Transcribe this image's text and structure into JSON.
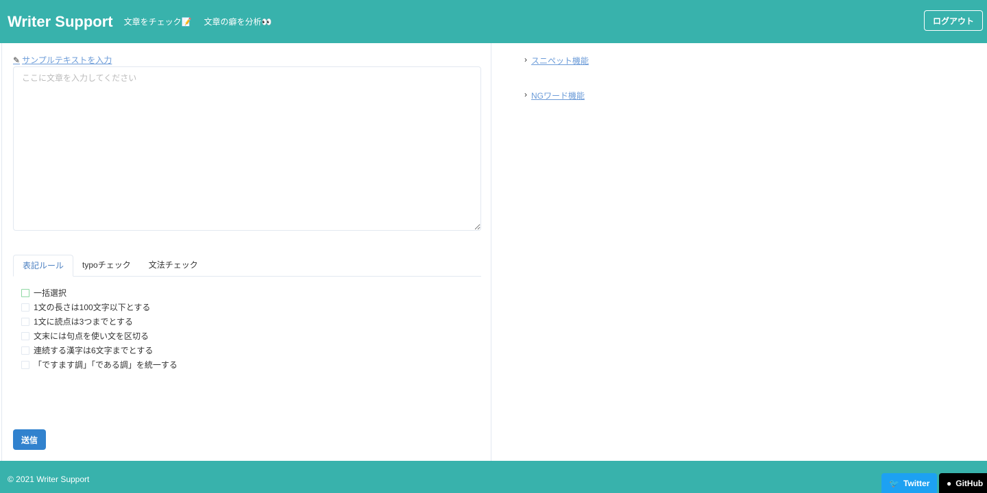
{
  "header": {
    "brand": "Writer Support",
    "nav": [
      "文章をチェック📝",
      "文章の癖を分析👀"
    ],
    "logout": "ログアウト"
  },
  "editor": {
    "sample_link": "サンプルテキストを入力",
    "placeholder": "ここに文章を入力してください",
    "value": ""
  },
  "tabs": [
    {
      "label": "表記ルール",
      "active": true
    },
    {
      "label": "typoチェック"
    },
    {
      "label": "文法チェック"
    }
  ],
  "rules": [
    {
      "label": "一括選択",
      "checked": false
    },
    {
      "label": "1文の長さは100文字以下とする",
      "checked": false
    },
    {
      "label": "1文に読点は3つまでとする",
      "checked": false
    },
    {
      "label": "文末には句点を使い文を区切る",
      "checked": false
    },
    {
      "label": "連続する漢字は6文字までとする",
      "checked": false
    },
    {
      "label": "「ですます調」「である調」を統一する",
      "checked": false
    }
  ],
  "submit": "送信",
  "sidebar": {
    "links": [
      "スニペット機能",
      "NGワード機能"
    ]
  },
  "footer": {
    "copyright": "© 2021 Writer Support",
    "twitter": "Twitter",
    "github": "GitHub"
  },
  "colors": {
    "brand": "#38b2ac",
    "primary": "#3182ce",
    "twitter": "#1da1f2"
  }
}
